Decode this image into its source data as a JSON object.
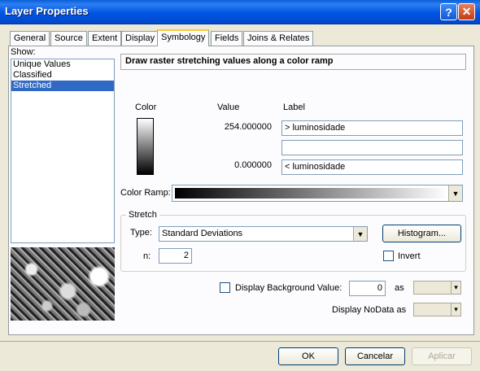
{
  "window": {
    "title": "Layer Properties"
  },
  "titlebar_buttons": {
    "help": "?",
    "close": "✕"
  },
  "tabs": [
    "General",
    "Source",
    "Extent",
    "Display",
    "Symbology",
    "Fields",
    "Joins & Relates"
  ],
  "active_tab": "Symbology",
  "show": {
    "label": "Show:",
    "items": [
      "Unique Values",
      "Classified",
      "Stretched"
    ],
    "selected": "Stretched"
  },
  "description": "Draw raster stretching values along a color ramp",
  "table": {
    "headers": {
      "color": "Color",
      "value": "Value",
      "label": "Label"
    },
    "rows": [
      {
        "value": "254.000000",
        "label": "> luminosidade"
      },
      {
        "value": "",
        "label": ""
      },
      {
        "value": "0.000000",
        "label": "< luminosidade"
      }
    ]
  },
  "color_ramp": {
    "label": "Color Ramp:",
    "from_color": "#000000",
    "to_color": "#ffffff"
  },
  "stretch": {
    "title": "Stretch",
    "type_label": "Type:",
    "type_value": "Standard Deviations",
    "histogram_button": "Histogram...",
    "n_label": "n:",
    "n_value": "2",
    "invert_label": "Invert",
    "invert_checked": false
  },
  "background": {
    "label": "Display Background Value:",
    "checked": false,
    "value": "0",
    "as_label": "as"
  },
  "nodata": {
    "label": "Display NoData as"
  },
  "buttons": {
    "ok": "OK",
    "cancel": "Cancelar",
    "apply": "Aplicar"
  },
  "colors": {
    "titlebar": "#0055e5",
    "selection": "#316ac5",
    "dialog_bg": "#ece9d8"
  }
}
